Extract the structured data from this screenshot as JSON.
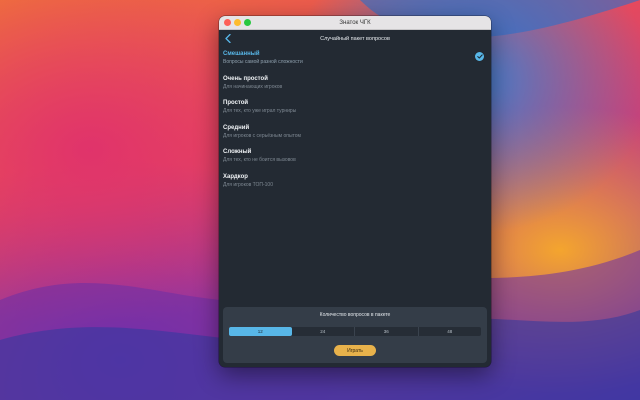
{
  "window": {
    "title": "Знаток ЧГК"
  },
  "navbar": {
    "title": "Случайный пакет вопросов",
    "back_icon": "chevron-left-icon"
  },
  "difficulty_items": [
    {
      "title": "Смешанный",
      "subtitle": "Вопросы самой разной сложности",
      "selected": true
    },
    {
      "title": "Очень простой",
      "subtitle": "Для начинающих игроков",
      "selected": false
    },
    {
      "title": "Простой",
      "subtitle": "Для тех, кто уже играл турниры",
      "selected": false
    },
    {
      "title": "Средний",
      "subtitle": "Для игроков с серьёзным опытом",
      "selected": false
    },
    {
      "title": "Сложный",
      "subtitle": "Для тех, кто не боится вызовов",
      "selected": false
    },
    {
      "title": "Хардкор",
      "subtitle": "Для игроков ТОП-100",
      "selected": false
    }
  ],
  "question_count": {
    "label": "Количество вопросов в пакете",
    "options": [
      "12",
      "24",
      "36",
      "48"
    ],
    "selected_index": 0
  },
  "start_button": {
    "label": "Играть"
  },
  "colors": {
    "accent": "#58b7e8",
    "window_bg": "#232a33",
    "panel_bg": "#343d48",
    "button": "#e8b24b"
  }
}
